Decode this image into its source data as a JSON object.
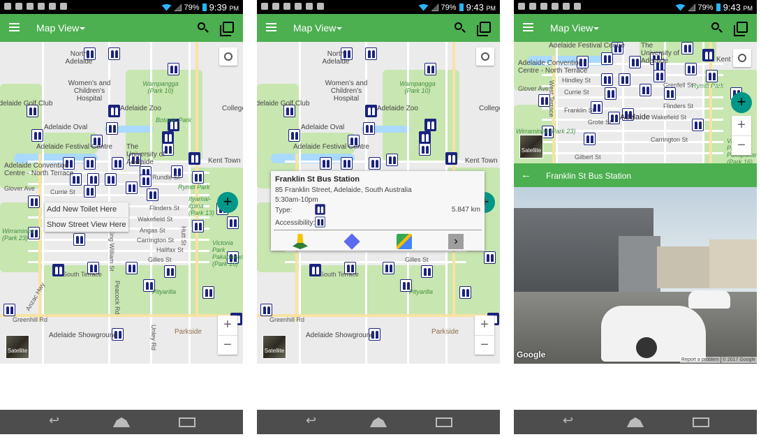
{
  "status_bar": {
    "battery": "79%",
    "times": [
      "9:39",
      "9:43",
      "9:43"
    ],
    "ampm": "PM"
  },
  "app_bar": {
    "title": "Map View"
  },
  "map_labels": {
    "north_adelaide": "North Adelaide",
    "hospital": "Women's and Children's Hospital",
    "warnpangga": "Warnpangga (Park 10)",
    "golf": "Adelaide Golf Club",
    "zoo": "Adelaide Zoo",
    "botanic": "Botanic Park",
    "college": "College",
    "oval": "Adelaide Oval",
    "festival": "Adelaide Festival Centre",
    "university": "The University of Adelaide",
    "kent_town": "Kent Town",
    "convention": "Adelaide Convention Centre - North Terrace",
    "rymill": "Rymill Park",
    "currie": "Currie St",
    "glover": "Glover Ave",
    "flinders": "Flinders St",
    "wakefield": "Wakefield St",
    "angas": "Angas St",
    "carrington": "Carrington St",
    "halifax": "Halifax St",
    "gilles": "Gilles St",
    "south_terrace": "South Terrace",
    "wirraminna": "Wirraminna (Park 23)",
    "victoria": "Victoria Park Pakapakanthi (Park 16)",
    "pityarilla": "Pityarilla",
    "greenhill": "Greenhill Rd",
    "showground": "Adelaide Showground",
    "parkside": "Parkside",
    "king_william": "King William St",
    "peacock": "Peacock Rd",
    "unley": "Unley Rd",
    "hutt": "Hutt St",
    "anzac": "Anzac Hwy",
    "hindley": "Hindley St",
    "franklin": "Franklin St",
    "grote": "Grote St",
    "adelaide": "Adelaide",
    "gilbert": "Gilbert St",
    "west_terrace": "West Terrace",
    "rundle": "Rundle St",
    "grenfell": "Grenfell St",
    "ityamai": "Ityamai-itpina (Park 13)"
  },
  "map_controls": {
    "satellite": "Satellite",
    "zoom_in": "+",
    "zoom_out": "−",
    "add": "+"
  },
  "context_menu": {
    "add_toilet": "Add New Toilet Here",
    "street_view": "Show Street View Here"
  },
  "popup": {
    "name": "Franklin St Bus Station",
    "address": "85 Franklin Street, Adelaide, South Australia",
    "hours": "5:30am-10pm",
    "type_label": "Type:",
    "accessibility_label": "Accessibility:",
    "distance": "5.847 km",
    "actions": [
      "street-view",
      "directions",
      "google-maps",
      "more"
    ]
  },
  "street_view": {
    "title": "Franklin St Bus Station",
    "google": "Google",
    "report": "Report a problem",
    "copyright": "© 2017 Google"
  },
  "colors": {
    "primary": "#4caf50",
    "fab": "#009688",
    "marker": "#1a237e"
  }
}
